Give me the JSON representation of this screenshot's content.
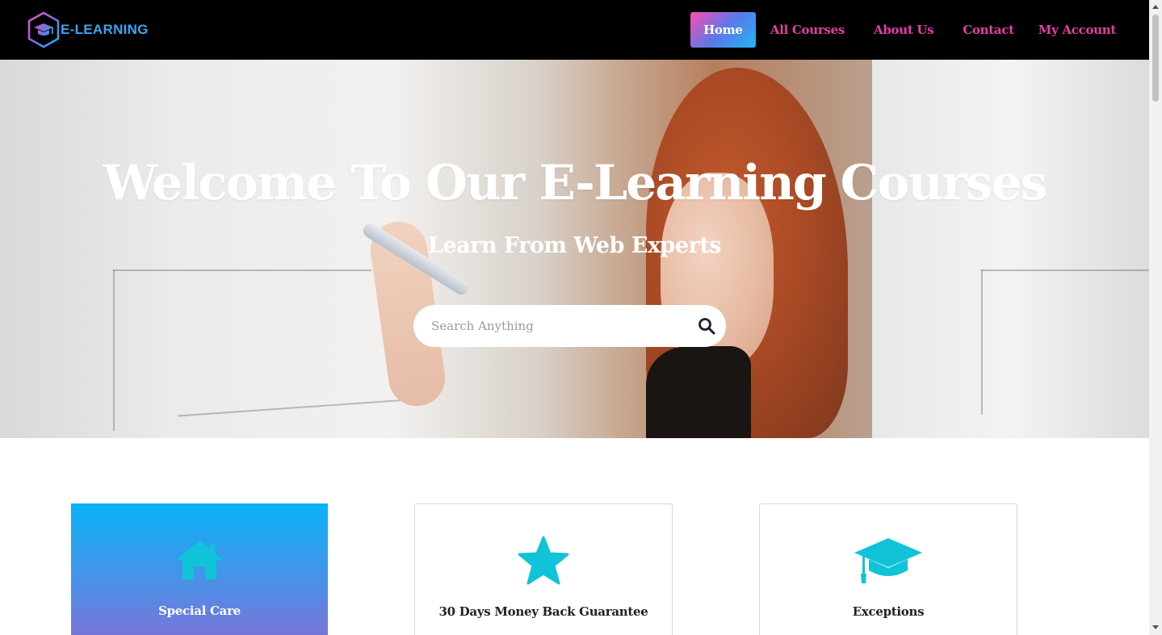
{
  "brand": {
    "name": "E-LEARNING",
    "accent": "#3fa3f0",
    "nav_color": "#e13fa4"
  },
  "nav": {
    "items": [
      {
        "label": "Home",
        "active": true
      },
      {
        "label": "All Courses"
      },
      {
        "label": "About Us"
      },
      {
        "label": "Contact"
      },
      {
        "label": "My Account"
      }
    ]
  },
  "hero": {
    "title": "Welcome To Our E-Learning Courses",
    "subtitle": "Learn From Web Experts",
    "search_placeholder": "Search Anything",
    "search_icon": "search-icon"
  },
  "features": [
    {
      "title": "Special Care",
      "icon": "home-icon",
      "active": true
    },
    {
      "title": "30 Days Money Back Guarantee",
      "icon": "star-icon"
    },
    {
      "title": "Exceptions",
      "icon": "graduation-cap-icon"
    }
  ]
}
